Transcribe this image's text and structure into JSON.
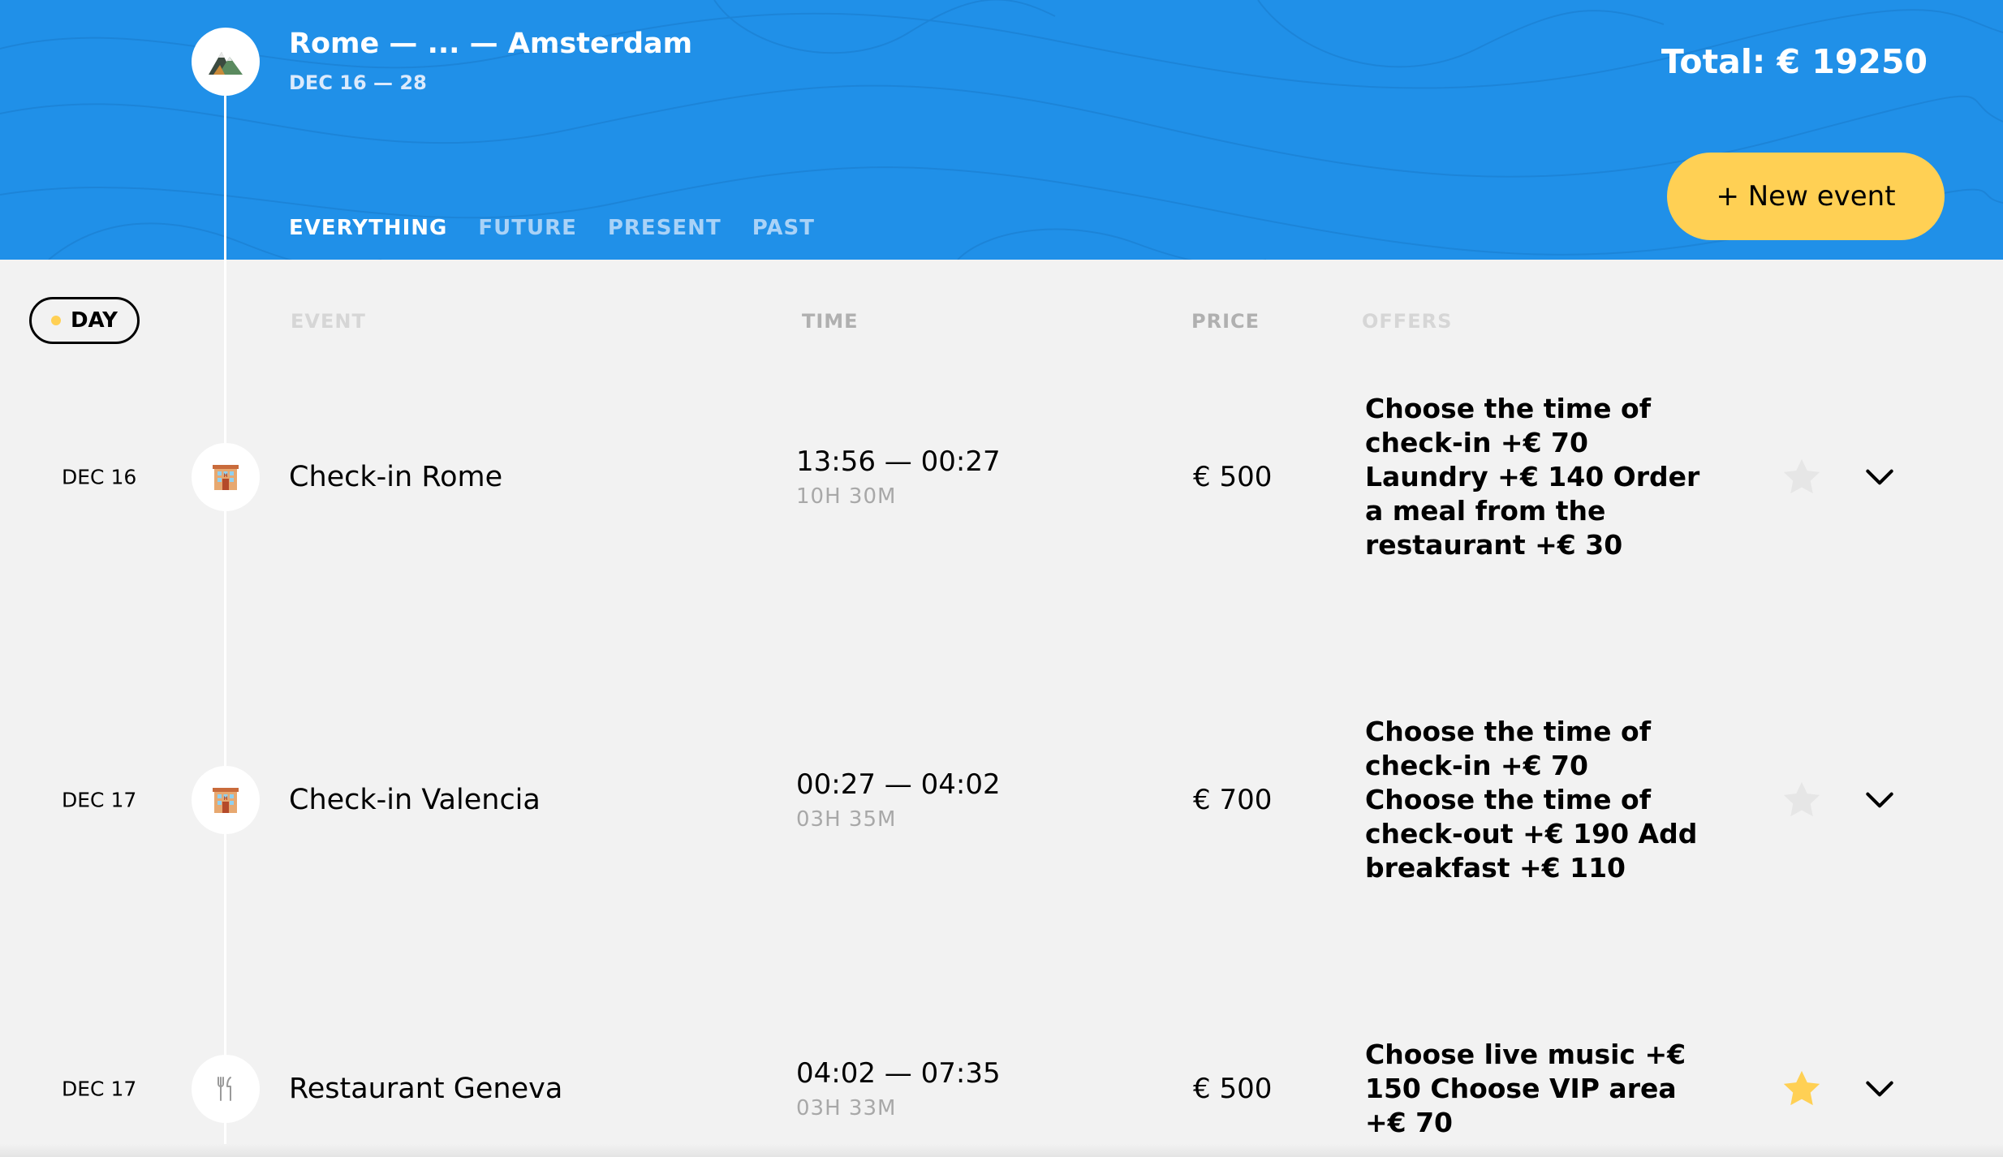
{
  "trip": {
    "route": "Rome — ... — Amsterdam",
    "dates": "DEC 16 — 28",
    "total": "Total: € 19250",
    "logo_icon": "mountains-icon"
  },
  "toolbar": {
    "new_event_label": "+ New event"
  },
  "filters": [
    {
      "label": "EVERYTHING",
      "active": true
    },
    {
      "label": "FUTURE",
      "active": false
    },
    {
      "label": "PRESENT",
      "active": false
    },
    {
      "label": "PAST",
      "active": false
    }
  ],
  "table": {
    "day_label": "DAY",
    "columns": {
      "event": "EVENT",
      "time": "TIME",
      "price": "PRICE",
      "offers": "OFFERS"
    }
  },
  "events": [
    {
      "date": "DEC 16",
      "icon": "hotel-icon",
      "name": "Check-in Rome",
      "time": "13:56 — 00:27",
      "duration": "10H 30M",
      "price": "€ 500",
      "offers": "Choose the time of check-in +€  70 Laundry +€  140 Order a meal from the restaurant +€  30",
      "favorite": false
    },
    {
      "date": "DEC 17",
      "icon": "hotel-icon",
      "name": "Check-in Valencia",
      "time": "00:27 — 04:02",
      "duration": "03H 35M",
      "price": "€ 700",
      "offers": "Choose the time of check-in +€  70 Choose the time of check-out +€  190 Add breakfast +€  110",
      "favorite": false
    },
    {
      "date": "DEC 17",
      "icon": "fork-knife-icon",
      "name": "Restaurant Geneva",
      "time": "04:02 — 07:35",
      "duration": "03H 33M",
      "price": "€ 500",
      "offers": "Choose live music +€ 150 Choose VIP area +€  70",
      "favorite": true
    }
  ],
  "colors": {
    "header_bg": "#2090e8",
    "accent_yellow": "#ffd054",
    "page_bg": "#f2f2f2",
    "star_inactive": "#e6e6e6",
    "star_active": "#ffd054",
    "column_head": "#cfcfcf"
  }
}
